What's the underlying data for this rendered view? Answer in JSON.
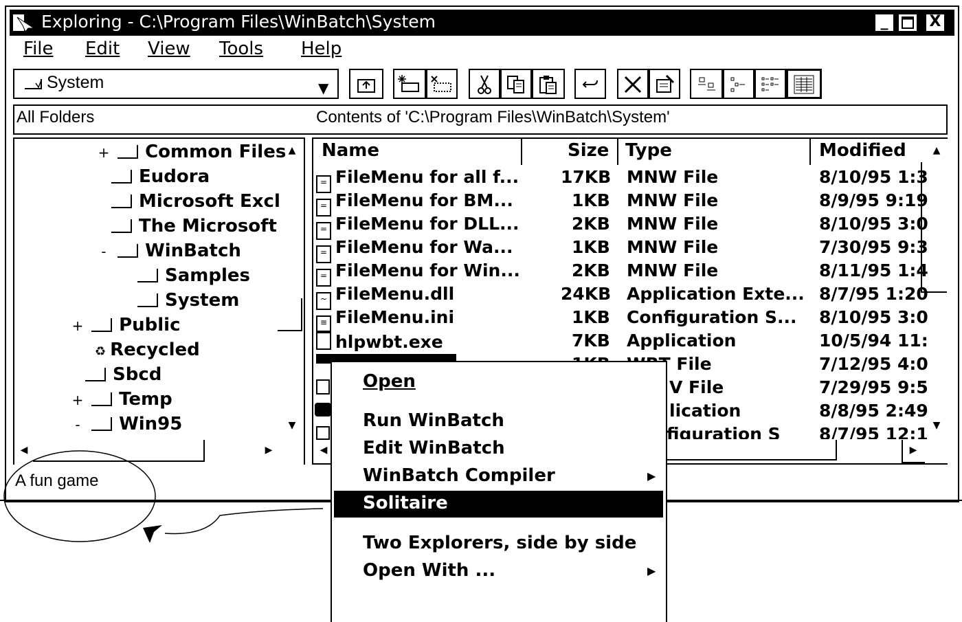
{
  "window": {
    "title": "Exploring - C:\\Program Files\\WinBatch\\System",
    "controls": {
      "minimize": "_",
      "maximize": "□",
      "close": "X"
    }
  },
  "menubar": [
    {
      "label": "File"
    },
    {
      "label": "Edit"
    },
    {
      "label": "View"
    },
    {
      "label": "Tools"
    },
    {
      "label": "Help"
    }
  ],
  "address": {
    "value": "System",
    "arrow": "▼"
  },
  "toolbar": {
    "buttons": [
      "up-folder-icon",
      "map-drive-icon",
      "disconnect-drive-icon",
      "cut-icon",
      "copy-icon",
      "paste-icon",
      "undo-icon",
      "delete-icon",
      "properties-icon",
      "large-icons-icon",
      "small-icons-icon",
      "list-icon",
      "details-icon"
    ]
  },
  "panes": {
    "left_header": "All Folders",
    "right_header": "Contents of 'C:\\Program Files\\WinBatch\\System'"
  },
  "tree": [
    {
      "label": "Common Files",
      "expander": "+"
    },
    {
      "label": "Eudora",
      "expander": ""
    },
    {
      "label": "Microsoft Excl",
      "expander": ""
    },
    {
      "label": "The Microsoft",
      "expander": ""
    },
    {
      "label": "WinBatch",
      "expander": "-"
    },
    {
      "label": "Samples",
      "expander": ""
    },
    {
      "label": "System",
      "expander": ""
    },
    {
      "label": "Public",
      "expander": "+"
    },
    {
      "label": "Recycled",
      "expander": ""
    },
    {
      "label": "Sbcd",
      "expander": ""
    },
    {
      "label": "Temp",
      "expander": "+"
    },
    {
      "label": "Win95",
      "expander": "-"
    }
  ],
  "list": {
    "columns": [
      "Name",
      "Size",
      "Type",
      "Modified"
    ],
    "rows": [
      {
        "name": "FileMenu for all f...",
        "size": "17KB",
        "type": "MNW File",
        "modified": "8/10/95 1:3"
      },
      {
        "name": "FileMenu for BM...",
        "size": "1KB",
        "type": "MNW File",
        "modified": "8/9/95 9:19"
      },
      {
        "name": "FileMenu for DLL...",
        "size": "2KB",
        "type": "MNW File",
        "modified": "8/10/95 3:0"
      },
      {
        "name": "FileMenu for Wa...",
        "size": "1KB",
        "type": "MNW File",
        "modified": "7/30/95 9:3"
      },
      {
        "name": "FileMenu for Win...",
        "size": "2KB",
        "type": "MNW File",
        "modified": "8/11/95 1:4"
      },
      {
        "name": "FileMenu.dll",
        "size": "24KB",
        "type": "Application Exte...",
        "modified": "8/7/95 1:20"
      },
      {
        "name": "FileMenu.ini",
        "size": "1KB",
        "type": "Configuration S...",
        "modified": "8/10/95 3:0"
      },
      {
        "name": "hlpwbt.exe",
        "size": "7KB",
        "type": "Application",
        "modified": "10/5/94 11:"
      },
      {
        "name": "",
        "size": "1KB",
        "type": "WBT File",
        "modified": "7/12/95 4:0"
      },
      {
        "name": "",
        "size": "",
        "type": "V File",
        "modified": "7/29/95 9:5"
      },
      {
        "name": "",
        "size": "",
        "type": "lication",
        "modified": "8/8/95 2:49"
      },
      {
        "name": "",
        "size": "",
        "type": "figuration S",
        "modified": "8/7/95 12:1"
      }
    ]
  },
  "status": {
    "text": "A fun game"
  },
  "context_menu": {
    "items": [
      {
        "label": "Open",
        "bold": true,
        "submenu": false
      },
      {
        "label": "Run WinBatch",
        "submenu": false
      },
      {
        "label": "Edit WinBatch",
        "submenu": false
      },
      {
        "label": "WinBatch Compiler",
        "submenu": true
      },
      {
        "label": "Solitaire",
        "highlighted": true,
        "submenu": false
      },
      {
        "label": "Two Explorers, side by side",
        "submenu": false
      },
      {
        "label": "Open With ...",
        "submenu": true
      }
    ],
    "submenu_arrow": "▶"
  }
}
